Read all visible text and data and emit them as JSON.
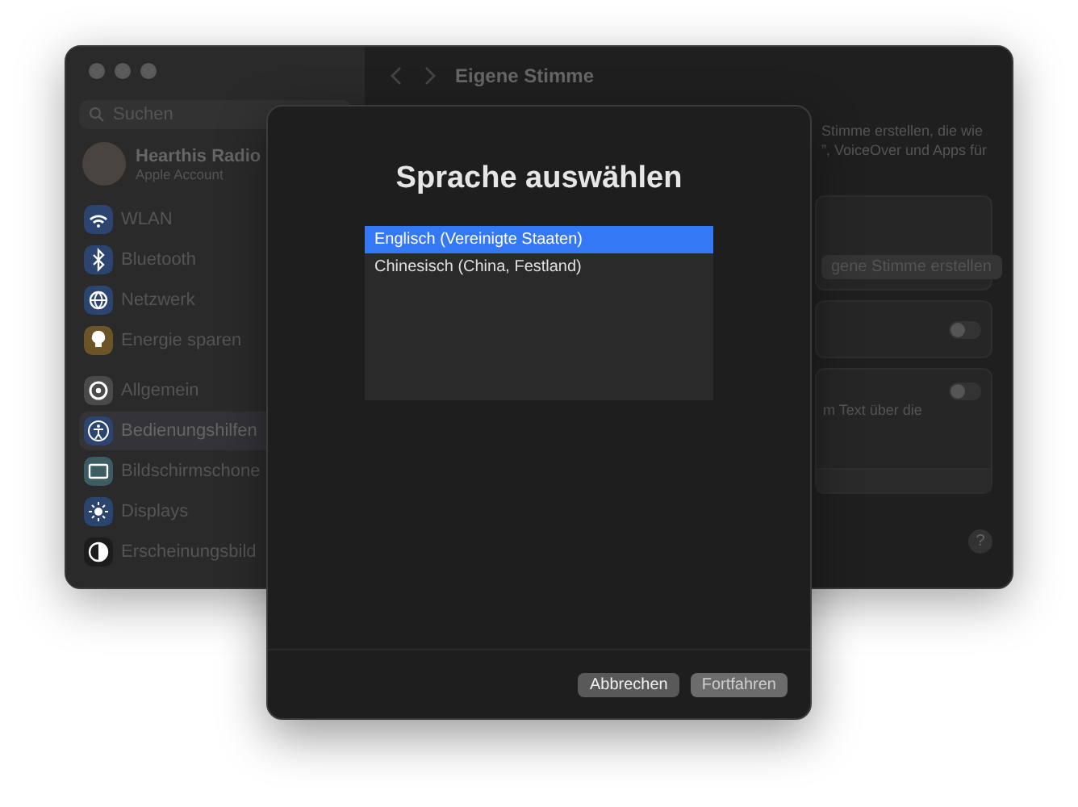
{
  "window": {
    "title": "Eigene Stimme"
  },
  "sidebar": {
    "search": {
      "placeholder": "Suchen"
    },
    "account": {
      "name": "Hearthis Radio",
      "subtitle": "Apple Account"
    },
    "groups": [
      [
        {
          "label": "WLAN",
          "color": "#2b4470",
          "selected": false
        },
        {
          "label": "Bluetooth",
          "color": "#2b4470",
          "selected": false
        },
        {
          "label": "Netzwerk",
          "color": "#2b4470",
          "selected": false
        },
        {
          "label": "Energie sparen",
          "color": "#6b5428",
          "selected": false
        }
      ],
      [
        {
          "label": "Allgemein",
          "color": "#4a4a4c",
          "selected": false
        },
        {
          "label": "Bedienungshilfen",
          "color": "#2b4470",
          "selected": true
        },
        {
          "label": "Bildschirmschone",
          "color": "#3d5c64",
          "selected": false
        },
        {
          "label": "Displays",
          "color": "#2b4470",
          "selected": false
        },
        {
          "label": "Erscheinungsbild",
          "color": "#1c1c1e",
          "selected": false
        }
      ]
    ]
  },
  "content": {
    "description_lines": [
      "Stimme erstellen, die wie",
      "”, VoiceOver und Apps für"
    ],
    "create_button": "gene Stimme erstellen",
    "toggles": [
      {
        "on": false
      }
    ],
    "toggle_card": {
      "on": false,
      "text": "m Text über die"
    },
    "help_button": "?"
  },
  "sheet": {
    "title": "Sprache auswählen",
    "languages": [
      {
        "label": "Englisch (Vereinigte Staaten)",
        "selected": true
      },
      {
        "label": "Chinesisch (China, Festland)",
        "selected": false
      }
    ],
    "buttons": [
      {
        "label": "Abbrechen",
        "kind": "secondary"
      },
      {
        "label": "Fortfahren",
        "kind": "primary"
      }
    ]
  }
}
